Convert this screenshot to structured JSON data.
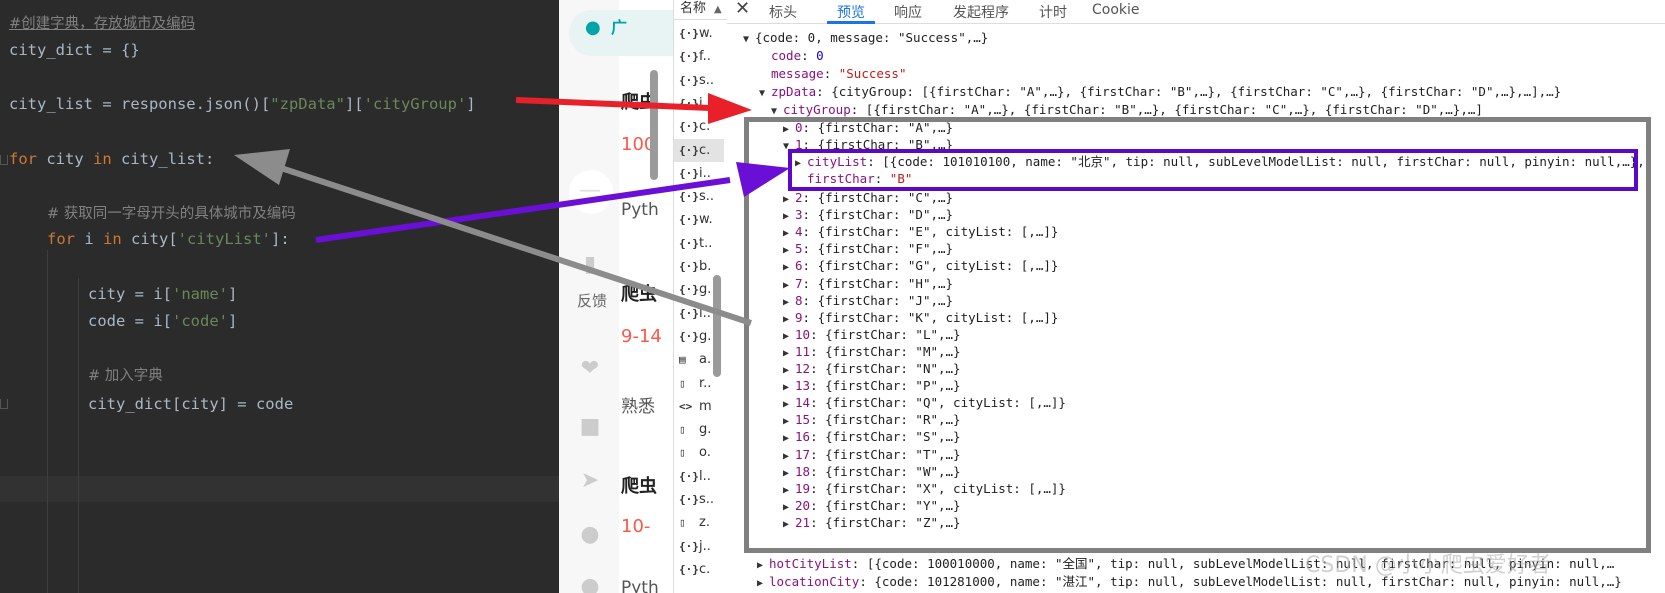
{
  "editor": {
    "comment1": "#创建字典，存放城市及编码",
    "line_city_dict": "city_dict = {}",
    "line_city_list_a": "city_list = response.json()[",
    "line_city_list_s1": "\"zpData\"",
    "line_city_list_b": "][",
    "line_city_list_s2": "'cityGroup'",
    "line_city_list_c": "]",
    "for1_kw": "for",
    "for1_mid": " city ",
    "for1_in": "in",
    "for1_rest": " city_list:",
    "comment2": "# 获取同一字母开头的具体城市及编码",
    "for2_kw": "for",
    "for2_mid": " i ",
    "for2_in": "in",
    "for2_a": " city[",
    "for2_s": "'cityList'",
    "for2_b": "]:",
    "city_a": "city = i[",
    "city_s": "'name'",
    "city_b": "]",
    "code_a": "code = i[",
    "code_s": "'code'",
    "code_b": "]",
    "comment3": "# 加入字典",
    "line_assign": "city_dict[city] = code"
  },
  "middle": {
    "loc_text": "广",
    "t1": "爬虫",
    "r1": "100",
    "g1": "Pyth",
    "feedback": "反馈",
    "t2": "爬虫",
    "r2": "9-14",
    "g2": "熟悉",
    "t3": "爬虫",
    "r3": "10-",
    "g3": "Pyth"
  },
  "files": {
    "header": "名称",
    "rows": [
      {
        "icon": "{·}",
        "name": "w."
      },
      {
        "icon": "{·}",
        "name": "f.."
      },
      {
        "icon": "{·}",
        "name": "s.."
      },
      {
        "icon": "{·}",
        "name": "i.."
      },
      {
        "icon": "{·}",
        "name": "c."
      },
      {
        "icon": "{·}",
        "name": "c."
      },
      {
        "icon": "{·}",
        "name": "i.."
      },
      {
        "icon": "{·}",
        "name": "s.."
      },
      {
        "icon": "{·}",
        "name": "w."
      },
      {
        "icon": "{·}",
        "name": "t.."
      },
      {
        "icon": "{·}",
        "name": "b."
      },
      {
        "icon": "{·}",
        "name": "g."
      },
      {
        "icon": "{·}",
        "name": "i.."
      },
      {
        "icon": "{·}",
        "name": "g."
      },
      {
        "icon": "▤",
        "name": "a."
      },
      {
        "icon": "▯",
        "name": "r.."
      },
      {
        "icon": "<>",
        "name": "m"
      },
      {
        "icon": "▯",
        "name": "g."
      },
      {
        "icon": "▯",
        "name": "o."
      },
      {
        "icon": "{·}",
        "name": "l.."
      },
      {
        "icon": "{·}",
        "name": "s.."
      },
      {
        "icon": "▯",
        "name": "z."
      },
      {
        "icon": "{·}",
        "name": "j.."
      },
      {
        "icon": "{·}",
        "name": "c."
      }
    ]
  },
  "devtools": {
    "tabs": [
      "标头",
      "预览",
      "响应",
      "发起程序",
      "计时",
      "Cookie"
    ],
    "active_tab": "预览",
    "root": "{code: 0, message: \"Success\",…}",
    "code_key": "code",
    "code_val": "0",
    "message_key": "message",
    "message_val": "\"Success\"",
    "zp_key": "zpData",
    "zp_val": "{cityGroup: [{firstChar: \"A\",…}, {firstChar: \"B\",…}, {firstChar: \"C\",…}, {firstChar: \"D\",…},…],…}",
    "cg_key": "cityGroup",
    "cg_val": "[{firstChar: \"A\",…}, {firstChar: \"B\",…}, {firstChar: \"C\",…}, {firstChar: \"D\",…},…]",
    "items": [
      {
        "idx": "0",
        "val": "{firstChar: \"A\",…}"
      },
      {
        "idx": "1",
        "val": "{firstChar: \"B\",…}"
      },
      {
        "idx": "2",
        "val": "{firstChar: \"C\",…}"
      },
      {
        "idx": "3",
        "val": "{firstChar: \"D\",…}"
      },
      {
        "idx": "4",
        "val": "{firstChar: \"E\", cityList: [,…]}"
      },
      {
        "idx": "5",
        "val": "{firstChar: \"F\",…}"
      },
      {
        "idx": "6",
        "val": "{firstChar: \"G\", cityList: [,…]}"
      },
      {
        "idx": "7",
        "val": "{firstChar: \"H\",…}"
      },
      {
        "idx": "8",
        "val": "{firstChar: \"J\",…}"
      },
      {
        "idx": "9",
        "val": "{firstChar: \"K\", cityList: [,…]}"
      },
      {
        "idx": "10",
        "val": "{firstChar: \"L\",…}"
      },
      {
        "idx": "11",
        "val": "{firstChar: \"M\",…}"
      },
      {
        "idx": "12",
        "val": "{firstChar: \"N\",…}"
      },
      {
        "idx": "13",
        "val": "{firstChar: \"P\",…}"
      },
      {
        "idx": "14",
        "val": "{firstChar: \"Q\", cityList: [,…]}"
      },
      {
        "idx": "15",
        "val": "{firstChar: \"R\",…}"
      },
      {
        "idx": "16",
        "val": "{firstChar: \"S\",…}"
      },
      {
        "idx": "17",
        "val": "{firstChar: \"T\",…}"
      },
      {
        "idx": "18",
        "val": "{firstChar: \"W\",…}"
      },
      {
        "idx": "19",
        "val": "{firstChar: \"X\", cityList: [,…]}"
      },
      {
        "idx": "20",
        "val": "{firstChar: \"Y\",…}"
      },
      {
        "idx": "21",
        "val": "{firstChar: \"Z\",…}"
      }
    ],
    "citylist_key": "cityList",
    "citylist_val": "[{code: 101010100, name: \"北京\", tip: null, subLevelModelList: null, firstChar: null, pinyin: null,…},",
    "firstchar_key": "firstChar",
    "firstchar_val": "\"B\"",
    "hot_key": "hotCityList",
    "hot_val": "[{code: 100010000, name: \"全国\", tip: null, subLevelModelList: null, firstChar: null, pinyin: null,…",
    "loc_key": "locationCity",
    "loc_val": "{code: 101281000, name: \"湛江\", tip: null, subLevelModelList: null, firstChar: null, pinyin: null,…}"
  },
  "watermark": "CSDN @小小爬虫爱好者",
  "colors": {
    "arrow_red": "#e8202a",
    "arrow_purple": "#6a0fd6",
    "arrow_gray": "#8c8c8c",
    "box_gray": "#808080",
    "box_purple": "#5b08c9"
  }
}
